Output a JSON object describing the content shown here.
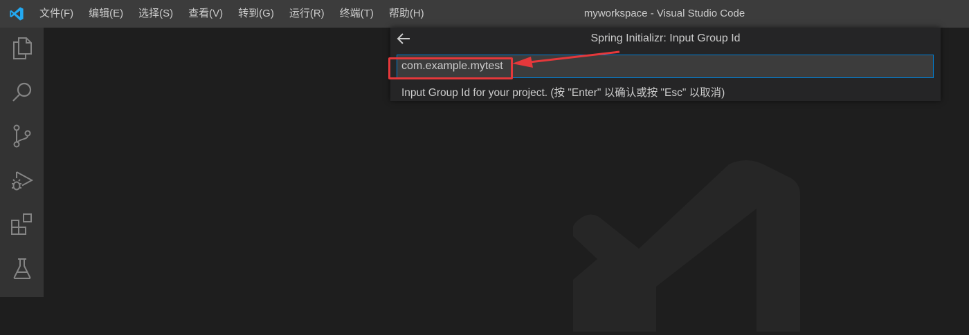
{
  "titlebar": {
    "menu": [
      "文件(F)",
      "编辑(E)",
      "选择(S)",
      "查看(V)",
      "转到(G)",
      "运行(R)",
      "终端(T)",
      "帮助(H)"
    ],
    "window_title": "myworkspace - Visual Studio Code"
  },
  "activity_bar": {
    "items": [
      "explorer-icon",
      "search-icon",
      "source-control-icon",
      "run-debug-icon",
      "extensions-icon",
      "testing-icon"
    ]
  },
  "quick_input": {
    "title": "Spring Initializr: Input Group Id",
    "value": "com.example.mytest",
    "message": "Input Group Id for your project. (按 \"Enter\" 以确认或按 \"Esc\" 以取消)"
  },
  "colors": {
    "titlebar": "#3c3c3c",
    "activity_bar": "#333333",
    "editor": "#1e1e1e",
    "focus_border": "#007fd4",
    "annotation": "#e5383b",
    "logo": "#23a9f2"
  }
}
